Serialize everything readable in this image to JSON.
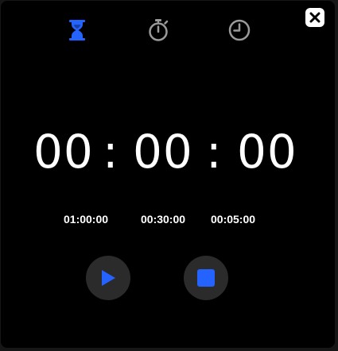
{
  "colors": {
    "accent": "#2563ff",
    "icon_inactive": "#9a9a9a",
    "button_bg": "#2b2b2b",
    "background": "#000000",
    "text": "#ffffff"
  },
  "toolbar": {
    "tabs": [
      {
        "icon": "hourglass-icon",
        "active": true
      },
      {
        "icon": "stopwatch-icon",
        "active": false
      },
      {
        "icon": "clock-icon",
        "active": false
      }
    ],
    "close_icon": "close-icon"
  },
  "display": {
    "hours": "00",
    "minutes": "00",
    "seconds": "00",
    "separator": ":"
  },
  "presets": [
    "01:00:00",
    "00:30:00",
    "00:05:00"
  ],
  "controls": {
    "play_icon": "play-icon",
    "stop_icon": "stop-icon"
  }
}
